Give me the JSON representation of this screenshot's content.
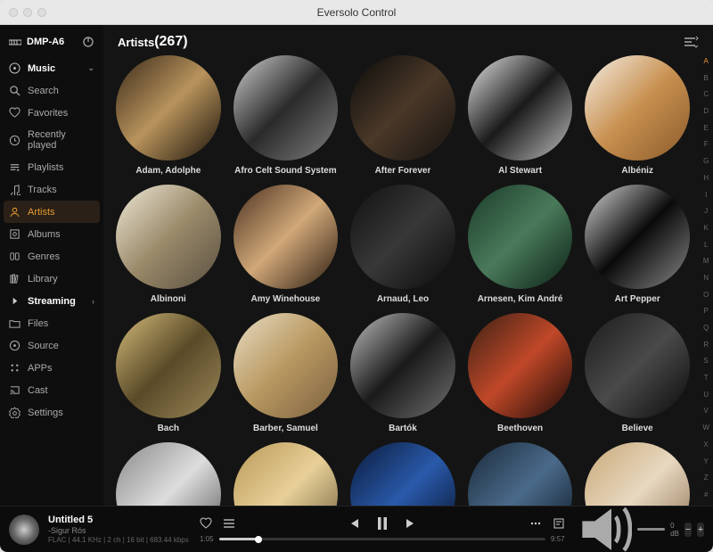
{
  "window": {
    "title": "Eversolo Control"
  },
  "device": {
    "name": "DMP-A6"
  },
  "sidebar": {
    "music_label": "Music",
    "items": [
      {
        "label": "Search",
        "icon": "search"
      },
      {
        "label": "Favorites",
        "icon": "heart"
      },
      {
        "label": "Recently played",
        "icon": "clock"
      },
      {
        "label": "Playlists",
        "icon": "playlist"
      },
      {
        "label": "Tracks",
        "icon": "music-note"
      },
      {
        "label": "Artists",
        "icon": "person"
      },
      {
        "label": "Albums",
        "icon": "album"
      },
      {
        "label": "Genres",
        "icon": "tag"
      },
      {
        "label": "Library",
        "icon": "library"
      }
    ],
    "streaming_label": "Streaming",
    "bottom": [
      {
        "label": "Files",
        "icon": "folder"
      },
      {
        "label": "Source",
        "icon": "source"
      },
      {
        "label": "APPs",
        "icon": "apps"
      },
      {
        "label": "Cast",
        "icon": "cast"
      },
      {
        "label": "Settings",
        "icon": "settings"
      }
    ]
  },
  "main": {
    "title": "Artists",
    "count": "(267)",
    "artists": [
      {
        "name": "Adam, Adolphe",
        "cls": "g1"
      },
      {
        "name": "Afro Celt Sound System",
        "cls": "g2"
      },
      {
        "name": "After Forever",
        "cls": "g3"
      },
      {
        "name": "Al Stewart",
        "cls": "g4"
      },
      {
        "name": "Albéniz",
        "cls": "g5"
      },
      {
        "name": "Albinoni",
        "cls": "g6"
      },
      {
        "name": "Amy Winehouse",
        "cls": "g7"
      },
      {
        "name": "Arnaud, Leo",
        "cls": "g8"
      },
      {
        "name": "Arnesen, Kim André",
        "cls": "g9"
      },
      {
        "name": "Art Pepper",
        "cls": "g10"
      },
      {
        "name": "Bach",
        "cls": "g11"
      },
      {
        "name": "Barber, Samuel",
        "cls": "g12"
      },
      {
        "name": "Bartók",
        "cls": "g13"
      },
      {
        "name": "Beethoven",
        "cls": "g14"
      },
      {
        "name": "Believe",
        "cls": "g15"
      },
      {
        "name": "",
        "cls": "g16"
      },
      {
        "name": "",
        "cls": "g17"
      },
      {
        "name": "",
        "cls": "g18"
      },
      {
        "name": "",
        "cls": "g19"
      },
      {
        "name": "",
        "cls": "g20"
      }
    ]
  },
  "alpha": [
    "A",
    "B",
    "C",
    "D",
    "E",
    "F",
    "G",
    "H",
    "I",
    "J",
    "K",
    "L",
    "M",
    "N",
    "O",
    "P",
    "Q",
    "R",
    "S",
    "T",
    "U",
    "V",
    "W",
    "X",
    "Y",
    "Z",
    "#"
  ],
  "alpha_active": "A",
  "player": {
    "title": "Untitled 5",
    "artist": "-Sigur Rós",
    "format": "FLAC | 44.1 KHz | 2 ch | 16 bit | 683.44 kbps",
    "elapsed": "1:05",
    "total": "9:57",
    "volume_db": "0 dB",
    "minus": "−",
    "plus": "+"
  }
}
